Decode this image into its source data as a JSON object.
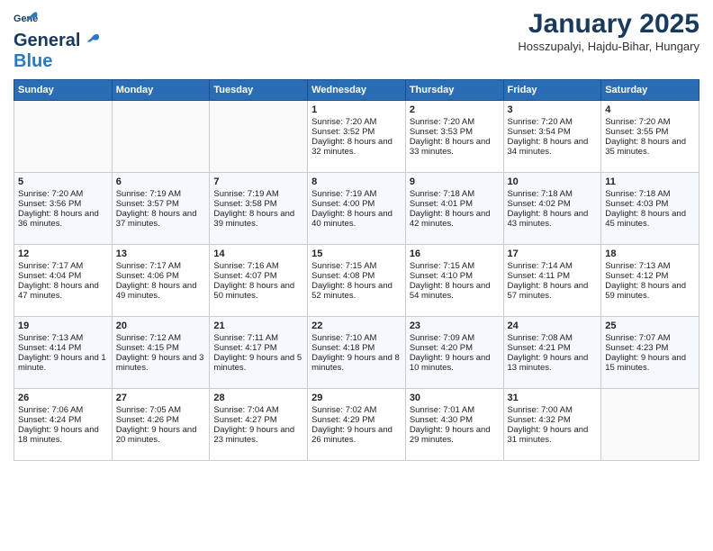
{
  "header": {
    "logo_general": "General",
    "logo_blue": "Blue",
    "title": "January 2025",
    "subtitle": "Hosszupalyi, Hajdu-Bihar, Hungary"
  },
  "weekdays": [
    "Sunday",
    "Monday",
    "Tuesday",
    "Wednesday",
    "Thursday",
    "Friday",
    "Saturday"
  ],
  "weeks": [
    [
      {
        "day": "",
        "sunrise": "",
        "sunset": "",
        "daylight": ""
      },
      {
        "day": "",
        "sunrise": "",
        "sunset": "",
        "daylight": ""
      },
      {
        "day": "",
        "sunrise": "",
        "sunset": "",
        "daylight": ""
      },
      {
        "day": "1",
        "sunrise": "Sunrise: 7:20 AM",
        "sunset": "Sunset: 3:52 PM",
        "daylight": "Daylight: 8 hours and 32 minutes."
      },
      {
        "day": "2",
        "sunrise": "Sunrise: 7:20 AM",
        "sunset": "Sunset: 3:53 PM",
        "daylight": "Daylight: 8 hours and 33 minutes."
      },
      {
        "day": "3",
        "sunrise": "Sunrise: 7:20 AM",
        "sunset": "Sunset: 3:54 PM",
        "daylight": "Daylight: 8 hours and 34 minutes."
      },
      {
        "day": "4",
        "sunrise": "Sunrise: 7:20 AM",
        "sunset": "Sunset: 3:55 PM",
        "daylight": "Daylight: 8 hours and 35 minutes."
      }
    ],
    [
      {
        "day": "5",
        "sunrise": "Sunrise: 7:20 AM",
        "sunset": "Sunset: 3:56 PM",
        "daylight": "Daylight: 8 hours and 36 minutes."
      },
      {
        "day": "6",
        "sunrise": "Sunrise: 7:19 AM",
        "sunset": "Sunset: 3:57 PM",
        "daylight": "Daylight: 8 hours and 37 minutes."
      },
      {
        "day": "7",
        "sunrise": "Sunrise: 7:19 AM",
        "sunset": "Sunset: 3:58 PM",
        "daylight": "Daylight: 8 hours and 39 minutes."
      },
      {
        "day": "8",
        "sunrise": "Sunrise: 7:19 AM",
        "sunset": "Sunset: 4:00 PM",
        "daylight": "Daylight: 8 hours and 40 minutes."
      },
      {
        "day": "9",
        "sunrise": "Sunrise: 7:18 AM",
        "sunset": "Sunset: 4:01 PM",
        "daylight": "Daylight: 8 hours and 42 minutes."
      },
      {
        "day": "10",
        "sunrise": "Sunrise: 7:18 AM",
        "sunset": "Sunset: 4:02 PM",
        "daylight": "Daylight: 8 hours and 43 minutes."
      },
      {
        "day": "11",
        "sunrise": "Sunrise: 7:18 AM",
        "sunset": "Sunset: 4:03 PM",
        "daylight": "Daylight: 8 hours and 45 minutes."
      }
    ],
    [
      {
        "day": "12",
        "sunrise": "Sunrise: 7:17 AM",
        "sunset": "Sunset: 4:04 PM",
        "daylight": "Daylight: 8 hours and 47 minutes."
      },
      {
        "day": "13",
        "sunrise": "Sunrise: 7:17 AM",
        "sunset": "Sunset: 4:06 PM",
        "daylight": "Daylight: 8 hours and 49 minutes."
      },
      {
        "day": "14",
        "sunrise": "Sunrise: 7:16 AM",
        "sunset": "Sunset: 4:07 PM",
        "daylight": "Daylight: 8 hours and 50 minutes."
      },
      {
        "day": "15",
        "sunrise": "Sunrise: 7:15 AM",
        "sunset": "Sunset: 4:08 PM",
        "daylight": "Daylight: 8 hours and 52 minutes."
      },
      {
        "day": "16",
        "sunrise": "Sunrise: 7:15 AM",
        "sunset": "Sunset: 4:10 PM",
        "daylight": "Daylight: 8 hours and 54 minutes."
      },
      {
        "day": "17",
        "sunrise": "Sunrise: 7:14 AM",
        "sunset": "Sunset: 4:11 PM",
        "daylight": "Daylight: 8 hours and 57 minutes."
      },
      {
        "day": "18",
        "sunrise": "Sunrise: 7:13 AM",
        "sunset": "Sunset: 4:12 PM",
        "daylight": "Daylight: 8 hours and 59 minutes."
      }
    ],
    [
      {
        "day": "19",
        "sunrise": "Sunrise: 7:13 AM",
        "sunset": "Sunset: 4:14 PM",
        "daylight": "Daylight: 9 hours and 1 minute."
      },
      {
        "day": "20",
        "sunrise": "Sunrise: 7:12 AM",
        "sunset": "Sunset: 4:15 PM",
        "daylight": "Daylight: 9 hours and 3 minutes."
      },
      {
        "day": "21",
        "sunrise": "Sunrise: 7:11 AM",
        "sunset": "Sunset: 4:17 PM",
        "daylight": "Daylight: 9 hours and 5 minutes."
      },
      {
        "day": "22",
        "sunrise": "Sunrise: 7:10 AM",
        "sunset": "Sunset: 4:18 PM",
        "daylight": "Daylight: 9 hours and 8 minutes."
      },
      {
        "day": "23",
        "sunrise": "Sunrise: 7:09 AM",
        "sunset": "Sunset: 4:20 PM",
        "daylight": "Daylight: 9 hours and 10 minutes."
      },
      {
        "day": "24",
        "sunrise": "Sunrise: 7:08 AM",
        "sunset": "Sunset: 4:21 PM",
        "daylight": "Daylight: 9 hours and 13 minutes."
      },
      {
        "day": "25",
        "sunrise": "Sunrise: 7:07 AM",
        "sunset": "Sunset: 4:23 PM",
        "daylight": "Daylight: 9 hours and 15 minutes."
      }
    ],
    [
      {
        "day": "26",
        "sunrise": "Sunrise: 7:06 AM",
        "sunset": "Sunset: 4:24 PM",
        "daylight": "Daylight: 9 hours and 18 minutes."
      },
      {
        "day": "27",
        "sunrise": "Sunrise: 7:05 AM",
        "sunset": "Sunset: 4:26 PM",
        "daylight": "Daylight: 9 hours and 20 minutes."
      },
      {
        "day": "28",
        "sunrise": "Sunrise: 7:04 AM",
        "sunset": "Sunset: 4:27 PM",
        "daylight": "Daylight: 9 hours and 23 minutes."
      },
      {
        "day": "29",
        "sunrise": "Sunrise: 7:02 AM",
        "sunset": "Sunset: 4:29 PM",
        "daylight": "Daylight: 9 hours and 26 minutes."
      },
      {
        "day": "30",
        "sunrise": "Sunrise: 7:01 AM",
        "sunset": "Sunset: 4:30 PM",
        "daylight": "Daylight: 9 hours and 29 minutes."
      },
      {
        "day": "31",
        "sunrise": "Sunrise: 7:00 AM",
        "sunset": "Sunset: 4:32 PM",
        "daylight": "Daylight: 9 hours and 31 minutes."
      },
      {
        "day": "",
        "sunrise": "",
        "sunset": "",
        "daylight": ""
      }
    ]
  ]
}
